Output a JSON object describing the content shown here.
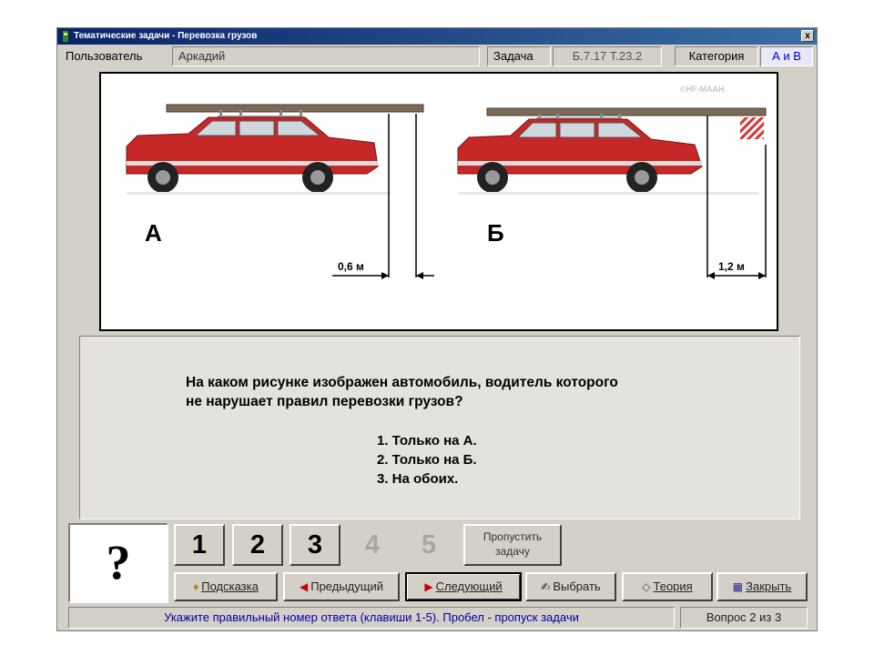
{
  "window": {
    "title": "Тематические задачи - Перевозка грузов",
    "close_label": "x"
  },
  "infobar": {
    "user_label": "Пользователь",
    "user_name": "Аркадий",
    "task_label": "Задача",
    "task_code": "Б.7.17  Т.23.2",
    "category_label": "Категория",
    "category_value": "А и В"
  },
  "picture": {
    "watermark": "©HF-MAAH",
    "label_a": "А",
    "label_b": "Б",
    "measure_a": "0,6 м",
    "measure_b": "1,2 м",
    "car_color": "#cc2a2a"
  },
  "question": {
    "text_line1": "На каком рисунке изображен автомобиль, водитель которого",
    "text_line2": "не нарушает правил перевозки грузов?",
    "answers": [
      "1. Только на А.",
      "2. Только на Б.",
      "3. На обоих."
    ]
  },
  "answer_box": {
    "symbol": "?"
  },
  "number_buttons": [
    {
      "label": "1",
      "enabled": true
    },
    {
      "label": "2",
      "enabled": true
    },
    {
      "label": "3",
      "enabled": true
    },
    {
      "label": "4",
      "enabled": false
    },
    {
      "label": "5",
      "enabled": false
    }
  ],
  "skip_button": {
    "line1": "Пропустить",
    "line2": "задачу"
  },
  "commands": {
    "hint": "Подсказка",
    "previous": "Предыдущий",
    "next": "Следующий",
    "choose": "Выбрать",
    "theory": "Теория",
    "close": "Закрыть"
  },
  "status": {
    "hint_text": "Укажите правильный номер ответа (клавиши 1-5). Пробел - пропуск задачи",
    "counter": "Вопрос 2 из 3"
  }
}
